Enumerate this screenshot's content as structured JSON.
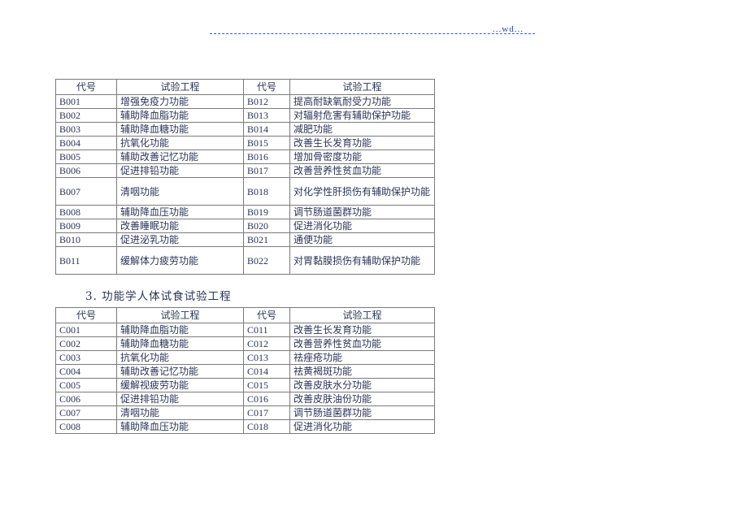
{
  "header": {
    "mark": "...wd..."
  },
  "table_b": {
    "headers": [
      "代号",
      "试验工程",
      "代号",
      "试验工程"
    ],
    "rows": [
      {
        "code1": "B001",
        "item1": "增强免疫力功能",
        "code2": "B012",
        "item2": "提高耐缺氧耐受力功能",
        "tall": false
      },
      {
        "code1": "B002",
        "item1": "辅助降血脂功能",
        "code2": "B013",
        "item2": "对辐射危害有辅助保护功能",
        "tall": false
      },
      {
        "code1": "B003",
        "item1": "辅助降血糖功能",
        "code2": "B014",
        "item2": "减肥功能",
        "tall": false
      },
      {
        "code1": "B004",
        "item1": "抗氧化功能",
        "code2": "B015",
        "item2": " 改善生长发育功能",
        "tall": false
      },
      {
        "code1": "B005",
        "item1": " 辅助改善记忆功能",
        "code2": "B016",
        "item2": " 增加骨密度功能",
        "tall": false
      },
      {
        "code1": "B006",
        "item1": "促进排铅功能",
        "code2": "B017",
        "item2": " 改善营养性贫血功能",
        "tall": false
      },
      {
        "code1": "B007",
        "item1": "清咽功能",
        "code2": "B018",
        "item2": " 对化学性肝损伤有辅助保护功能",
        "tall": true
      },
      {
        "code1": "B008",
        "item1": "辅助降血压功能",
        "code2": "B019",
        "item2": " 调节肠道菌群功能",
        "tall": false
      },
      {
        "code1": "B009",
        "item1": "改善睡眠功能",
        "code2": "B020",
        "item2": " 促进消化功能",
        "tall": false
      },
      {
        "code1": "B010",
        "item1": "促进泌乳功能",
        "code2": "B021",
        "item2": " 通便功能",
        "tall": false
      },
      {
        "code1": "B011",
        "item1": " 缓解体力疲劳功能",
        "code2": "B022",
        "item2": " 对胃黏膜损伤有辅助保护功能",
        "tall": true
      }
    ]
  },
  "section_title": "3. 功能学人体试食试验工程",
  "table_c": {
    "headers": [
      "代号",
      "试验工程",
      "代号",
      "试验工程"
    ],
    "rows": [
      {
        "code1": "C001",
        "item1": "辅助降血脂功能",
        "code2": "C011",
        "item2": " 改善生长发育功能"
      },
      {
        "code1": "C002",
        "item1": "辅助降血糖功能",
        "code2": "C012",
        "item2": " 改善营养性贫血功能"
      },
      {
        "code1": "C003",
        "item1": "抗氧化功能",
        "code2": "C013",
        "item2": " 祛痤疮功能"
      },
      {
        "code1": "C004",
        "item1": " 辅助改善记忆功能",
        "code2": "C014",
        "item2": " 祛黄褐斑功能"
      },
      {
        "code1": "C005",
        "item1": "缓解视疲劳功能",
        "code2": "C015",
        "item2": " 改善皮肤水分功能"
      },
      {
        "code1": "C006",
        "item1": "促进排铅功能",
        "code2": "C016",
        "item2": " 改善皮肤油份功能"
      },
      {
        "code1": "C007",
        "item1": "清咽功能",
        "code2": "C017",
        "item2": " 调节肠道菌群功能"
      },
      {
        "code1": "C008",
        "item1": "辅助降血压功能",
        "code2": "C018",
        "item2": " 促进消化功能"
      }
    ]
  }
}
